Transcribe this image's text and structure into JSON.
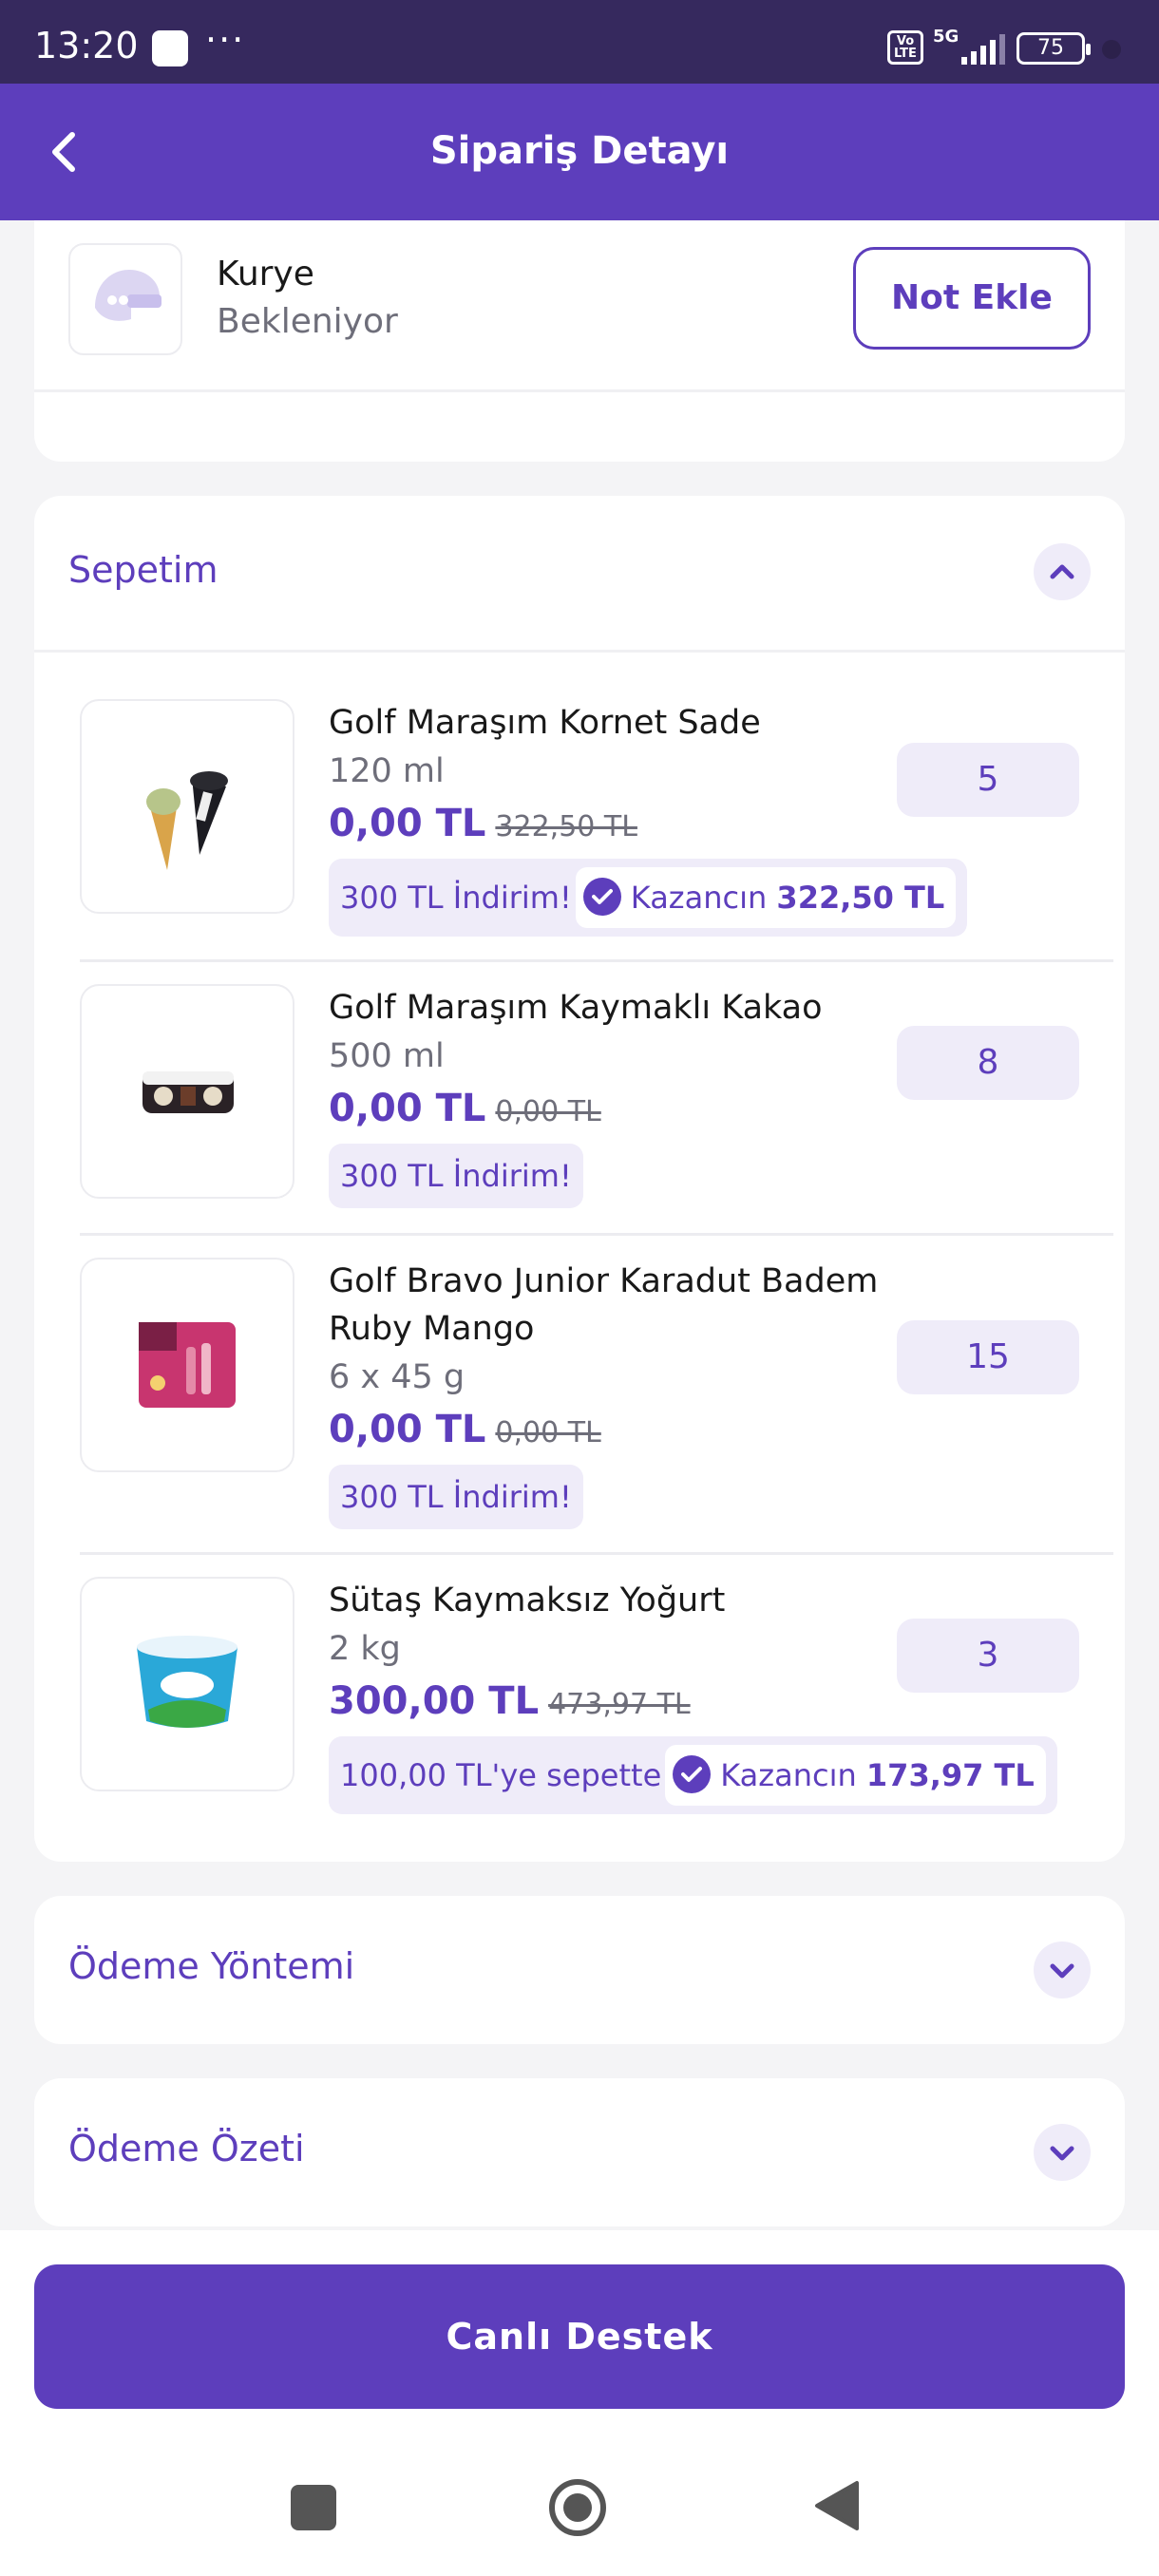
{
  "status_bar": {
    "time": "13:20",
    "volte": "Vo LTE",
    "network": "5G",
    "battery": "75"
  },
  "header": {
    "title": "Sipariş Detayı",
    "back_icon": "chevron-left-icon"
  },
  "courier": {
    "name": "Kurye",
    "status": "Bekleniyor",
    "note_button": "Not Ekle",
    "icon": "courier-helmet-icon"
  },
  "basket": {
    "title": "Sepetim",
    "toggle_icon": "chevron-up-icon",
    "items": [
      {
        "name": "Golf Maraşım Kornet Sade",
        "size": "120 ml",
        "price": "0,00 TL",
        "old_price": "322,50 TL",
        "quantity": "5",
        "promo": "300 TL İndirim!",
        "gain_label": "Kazancın",
        "gain_value": "322,50 TL"
      },
      {
        "name": "Golf Maraşım Kaymaklı Kakao",
        "size": "500 ml",
        "price": "0,00 TL",
        "old_price": "0,00 TL",
        "quantity": "8",
        "promo": "300 TL İndirim!"
      },
      {
        "name": "Golf Bravo Junior Karadut Badem Ruby Mango",
        "size": "6 x 45 g",
        "price": "0,00 TL",
        "old_price": "0,00 TL",
        "quantity": "15",
        "promo": "300 TL İndirim!"
      },
      {
        "name": "Sütaş Kaymaksız Yoğurt",
        "size": "2 kg",
        "price": "300,00 TL",
        "old_price": "473,97 TL",
        "quantity": "3",
        "promo": "100,00 TL'ye sepette",
        "gain_label": "Kazancın",
        "gain_value": "173,97 TL"
      }
    ]
  },
  "payment_method": {
    "title": "Ödeme Yöntemi",
    "toggle_icon": "chevron-down-icon"
  },
  "payment_summary": {
    "title": "Ödeme Özeti",
    "toggle_icon": "chevron-down-icon"
  },
  "support_button": "Canlı Destek",
  "colors": {
    "primary": "#5d3ebc",
    "status_bar": "#36295e",
    "chip_bg": "#efecf9",
    "muted_text": "#6e6e7a"
  }
}
